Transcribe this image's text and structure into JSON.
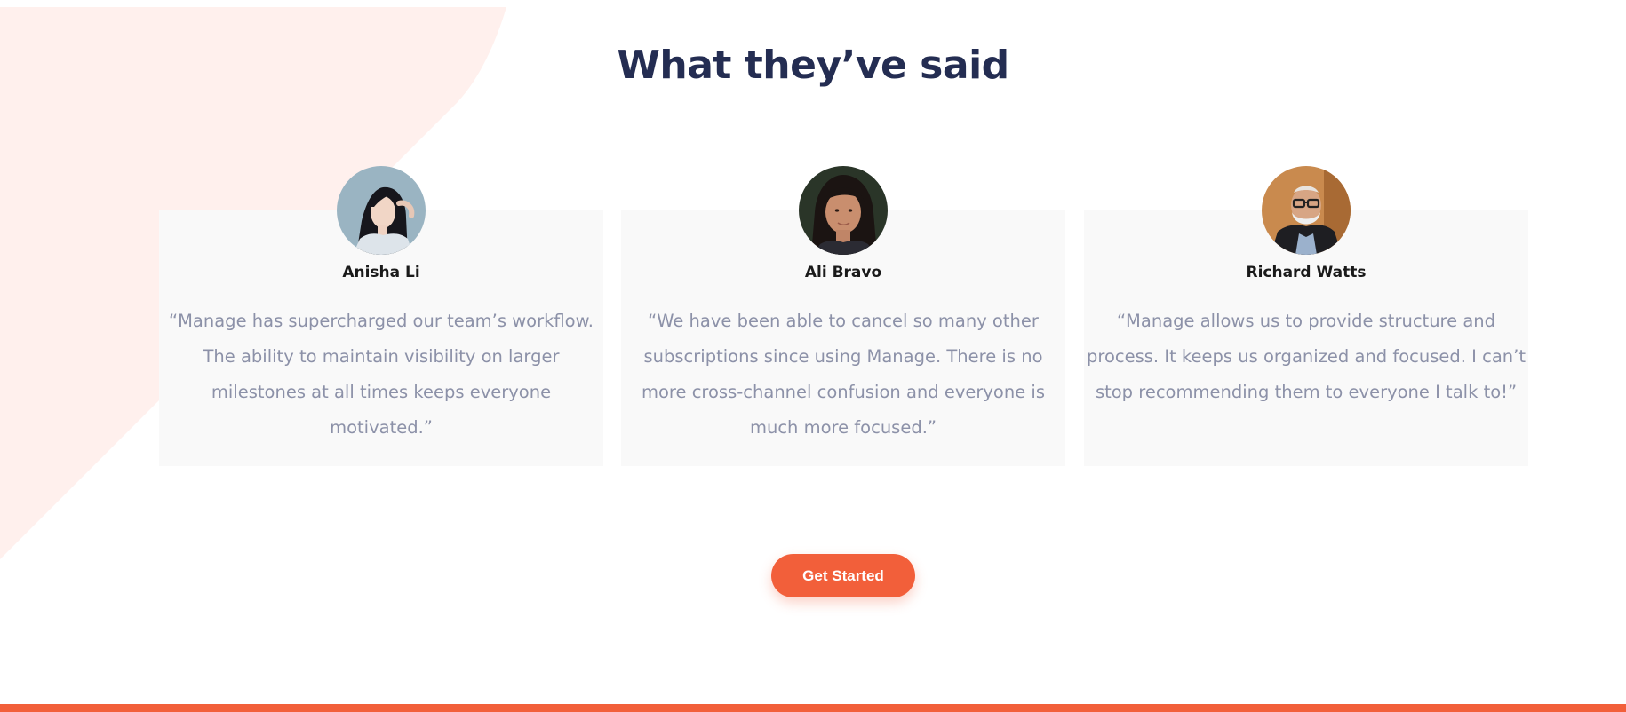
{
  "section": {
    "title": "What they’ve said"
  },
  "testimonials": [
    {
      "name": "Anisha Li",
      "quote": "“Manage has supercharged our team’s workflow. The ability to maintain visibility on larger milestones at all times keeps everyone motivated.”"
    },
    {
      "name": "Ali Bravo",
      "quote": "“We have been able to cancel so many other subscriptions since using Manage. There is no more cross-channel confusion and everyone is much more focused.”"
    },
    {
      "name": "Richard Watts",
      "quote": "“Manage allows us to provide structure and process. It keeps us organized and focused. I can’t stop recommending them to everyone I talk to!”"
    }
  ],
  "cta": {
    "label": "Get Started"
  },
  "colors": {
    "brand_orange": "#f25f3a",
    "heading_navy": "#242d52",
    "body_gray": "#8c91a8",
    "card_background": "#f9f9f9",
    "bg_shape_peach": "#fff0ed"
  }
}
